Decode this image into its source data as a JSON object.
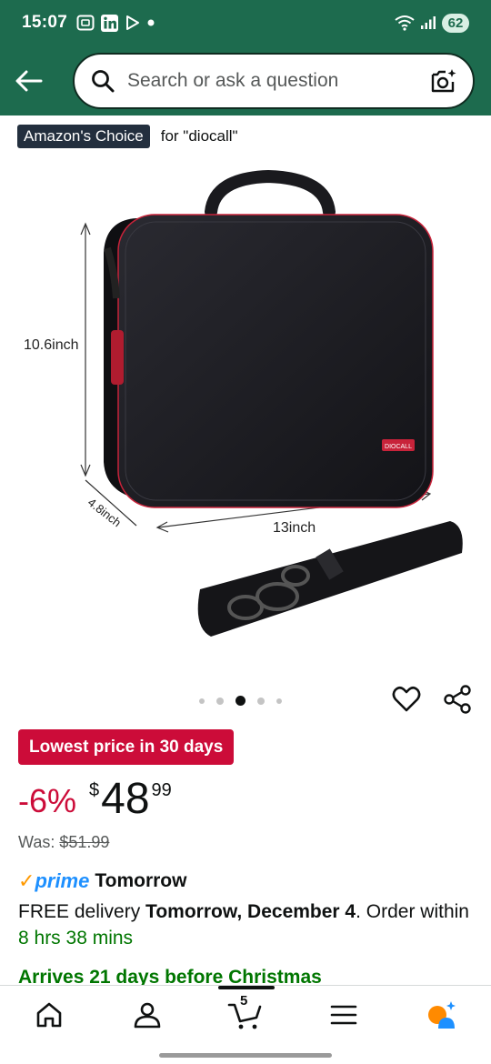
{
  "status_bar": {
    "time": "15:07",
    "battery": "62",
    "icons": [
      "screenshot-icon",
      "linkedin-icon",
      "play-icon",
      "dot-icon",
      "wifi-icon",
      "signal-icon"
    ]
  },
  "header": {
    "back_icon": "arrow-left-icon",
    "search_placeholder": "Search or ask a question",
    "camera_icon": "camera-lens-icon"
  },
  "badge": {
    "label": "Amazon's Choice",
    "for_text": "for \"diocall\""
  },
  "product_image": {
    "height_label": "10.6inch",
    "depth_label": "4.8inch",
    "width_label": "13inch",
    "brand_tag": "DIOCALL",
    "colors": {
      "case": "#1b1b20",
      "trim": "#c8233a"
    }
  },
  "carousel": {
    "count": 5,
    "active_index": 2
  },
  "deal": {
    "label": "Lowest price in 30 days",
    "color": "#cc0c39"
  },
  "price": {
    "discount": "-6%",
    "symbol": "$",
    "whole": "48",
    "fraction": "99",
    "was_label": "Was:",
    "was_value": "$51.99"
  },
  "delivery": {
    "prime_check": "✓",
    "prime_label": "prime",
    "prime_day": "Tomorrow",
    "line_prefix": "FREE delivery ",
    "line_date": "Tomorrow, December 4",
    "line_mid": ". Order within ",
    "countdown": "8 hrs 38 mins",
    "arrives": "Arrives 21 days before Christmas"
  },
  "bottom_nav": {
    "items": [
      "home-icon",
      "account-icon",
      "cart-icon",
      "menu-icon",
      "rufus-icon"
    ],
    "cart_count": "5"
  },
  "colors": {
    "header_bg": "#1d6b4e",
    "link_green": "#007600",
    "deal_red": "#cc0c39",
    "prime_blue": "#1e90ff"
  }
}
